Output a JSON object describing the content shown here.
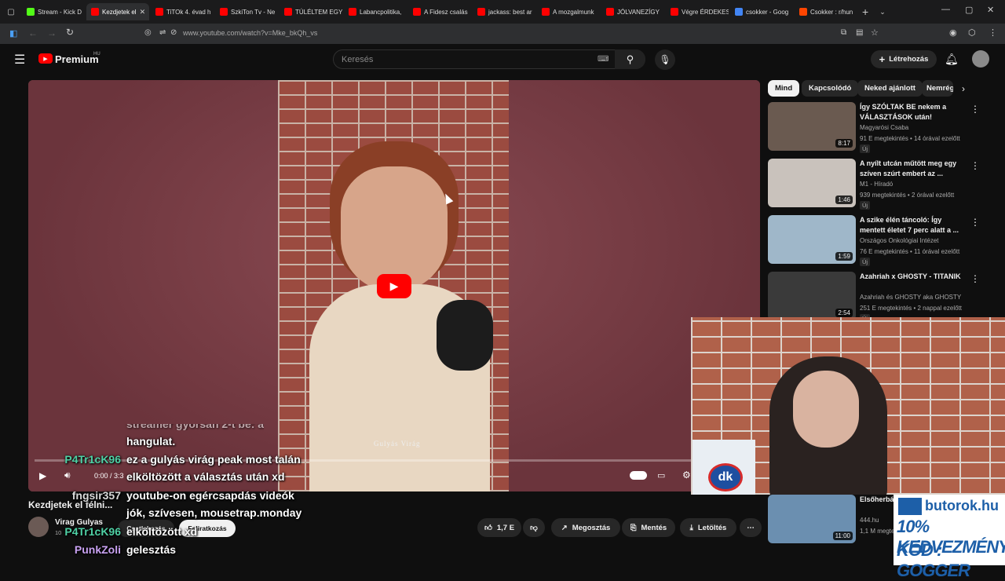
{
  "browser": {
    "tabs": [
      {
        "label": "Stream - Kick D",
        "color": "#53fc18",
        "active": false
      },
      {
        "label": "Kezdjetek el",
        "color": "#ff0000",
        "active": true
      },
      {
        "label": "TiTOk 4. évad h",
        "color": "#ff0000",
        "active": false
      },
      {
        "label": "SzkiTon Tv - Ne",
        "color": "#ff0000",
        "active": false
      },
      {
        "label": "TÚLÉLTEM EGY",
        "color": "#ff0000",
        "active": false
      },
      {
        "label": "Labancpolitika,",
        "color": "#ff0000",
        "active": false
      },
      {
        "label": "A Fidesz csalás",
        "color": "#ff0000",
        "active": false
      },
      {
        "label": "jackass: best ar",
        "color": "#ff0000",
        "active": false
      },
      {
        "label": "A mozgalmunk",
        "color": "#ff0000",
        "active": false
      },
      {
        "label": "JÓLVANEZÍGY",
        "color": "#ff0000",
        "active": false
      },
      {
        "label": "Végre ÉRDEKES",
        "color": "#ff0000",
        "active": false
      },
      {
        "label": "csokker - Goog",
        "color": "#4285f4",
        "active": false
      },
      {
        "label": "Csokker : r/hun",
        "color": "#ff4500",
        "active": false
      }
    ],
    "url": "www.youtube.com/watch?v=Mke_bkQh_vs"
  },
  "header": {
    "brand": "Premium",
    "region": "HU",
    "search_placeholder": "Keresés",
    "create_label": "Létrehozás"
  },
  "player": {
    "time": "0:00 / 3:3",
    "watermark": "Gulyás Virág",
    "progress": 0
  },
  "chips": [
    "Mind",
    "Kapcsolódó",
    "Neked ajánlott",
    "Nemrég"
  ],
  "recommendations": [
    {
      "title": "Így SZÓLTAK BE nekem a VÁLASZTÁSOK után!",
      "channel": "Magyarósi Csaba",
      "meta": "91 E megtekintés • 14 órával ezelőtt",
      "badge": "Új",
      "duration": "8:17",
      "thumb_color": "#6a5a50"
    },
    {
      "title": "A nyílt utcán műtött meg egy szíven szúrt embert az ...",
      "channel": "M1 - Híradó",
      "meta": "939 megtekintés • 2 órával ezelőtt",
      "badge": "Új",
      "duration": "1:46",
      "thumb_color": "#c9c2bc"
    },
    {
      "title": "A szike élén táncoló: Így mentett életet 7 perc alatt a ...",
      "channel": "Országos Onkológiai Intézet",
      "meta": "76 E megtekintés • 11 órával ezelőtt",
      "badge": "Új",
      "duration": "1:59",
      "thumb_color": "#9fb7c9"
    },
    {
      "title": "Azahriah x GHOSTY - TITANIK",
      "channel": "Azahriah és GHOSTY aka GHOSTY",
      "meta": "251 E megtekintés • 2 nappal ezelőtt",
      "badge": "Új",
      "duration": "2:54",
      "thumb_color": "#3a3a3a"
    },
    {
      "title": "Elsőherbál majálison",
      "channel": "444.hu",
      "meta": "1,1 M megte",
      "badge": "",
      "duration": "11:00",
      "thumb_color": "#6b8fb0"
    }
  ],
  "video": {
    "title": "Kezdjetek el félni...",
    "channel": "Virag Gulyas",
    "subscribers": "10",
    "join_label": "Csatlakozás",
    "subscribe_label": "Feliratkozás",
    "likes": "1,7 E",
    "share_label": "Megosztás",
    "save_label": "Mentés",
    "download_label": "Letöltés"
  },
  "chat": [
    {
      "user": "",
      "user_color": "#ffffff",
      "text": "streamer gyorsan 2-t be: a"
    },
    {
      "user": "",
      "user_color": "#ffffff",
      "text": "hangulat."
    },
    {
      "user": "P4Tr1cK96",
      "user_color": "#4fd1a5",
      "text": "ez a gulyás virág peak most talán"
    },
    {
      "user": "",
      "user_color": "#ffffff",
      "text": "elköltözött a választás után xd"
    },
    {
      "user": "fngsir357",
      "user_color": "#d9d9d9",
      "text": "youtube-on egércsapdás videók"
    },
    {
      "user": "",
      "user_color": "#ffffff",
      "text": "jók, szívesen, mousetrap.monday"
    },
    {
      "user": "P4Tr1cK96",
      "user_color": "#4fd1a5",
      "text": "elköltözött xd"
    },
    {
      "user": "PunkZoli",
      "user_color": "#c9a2f2",
      "text": "gelesztás"
    }
  ],
  "sponsor": {
    "brand": "butorok.hu",
    "line1": "10% KEDVEZMÉNY",
    "line2": "KÓD : GOGGER",
    "color": "#1d5fa8"
  },
  "webcam": {
    "sign": "dk"
  }
}
